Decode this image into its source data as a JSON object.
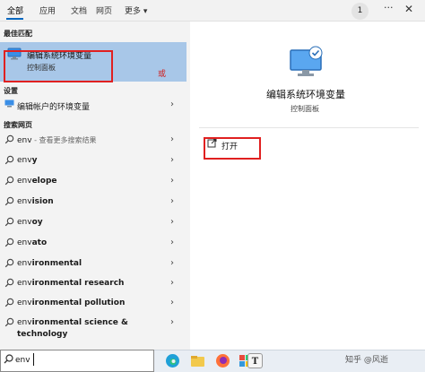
{
  "nav": {
    "tabs": [
      "全部",
      "应用",
      "文档",
      "网页",
      "更多"
    ],
    "more_chevron": "▾",
    "badge": "1",
    "more_icon": "···",
    "close_icon": "✕"
  },
  "sections": {
    "best_match": "最佳匹配",
    "settings": "设置",
    "web": "搜索网页"
  },
  "best_match": {
    "title": "编辑系统环境变量",
    "subtitle": "控制面板",
    "annotation": "或"
  },
  "settings_item": {
    "label": "编辑帐户的环境变量",
    "arrow": "›"
  },
  "web_results": [
    {
      "prefix": "env",
      "bold": "",
      "hint": " - 查看更多搜索结果"
    },
    {
      "prefix": "env",
      "bold": "y",
      "hint": ""
    },
    {
      "prefix": "env",
      "bold": "elope",
      "hint": ""
    },
    {
      "prefix": "env",
      "bold": "ision",
      "hint": ""
    },
    {
      "prefix": "env",
      "bold": "oy",
      "hint": ""
    },
    {
      "prefix": "env",
      "bold": "ato",
      "hint": ""
    },
    {
      "prefix": "env",
      "bold": "ironmental",
      "hint": ""
    },
    {
      "prefix": "env",
      "bold": "ironmental research",
      "hint": ""
    },
    {
      "prefix": "env",
      "bold": "ironmental pollution",
      "hint": ""
    },
    {
      "prefix": "env",
      "bold": "ironmental science &",
      "hint": ""
    }
  ],
  "web_result_wrap": "technology",
  "detail": {
    "title": "编辑系统环境变量",
    "subtitle": "控制面板",
    "open_label": "打开"
  },
  "taskbar": {
    "search_value": "env",
    "watermark": "知乎 @风逝",
    "text_app_label": "T"
  },
  "colors": {
    "accent": "#0067c0",
    "highlight": "#a8c7e8",
    "annotation_red": "#e02020"
  }
}
